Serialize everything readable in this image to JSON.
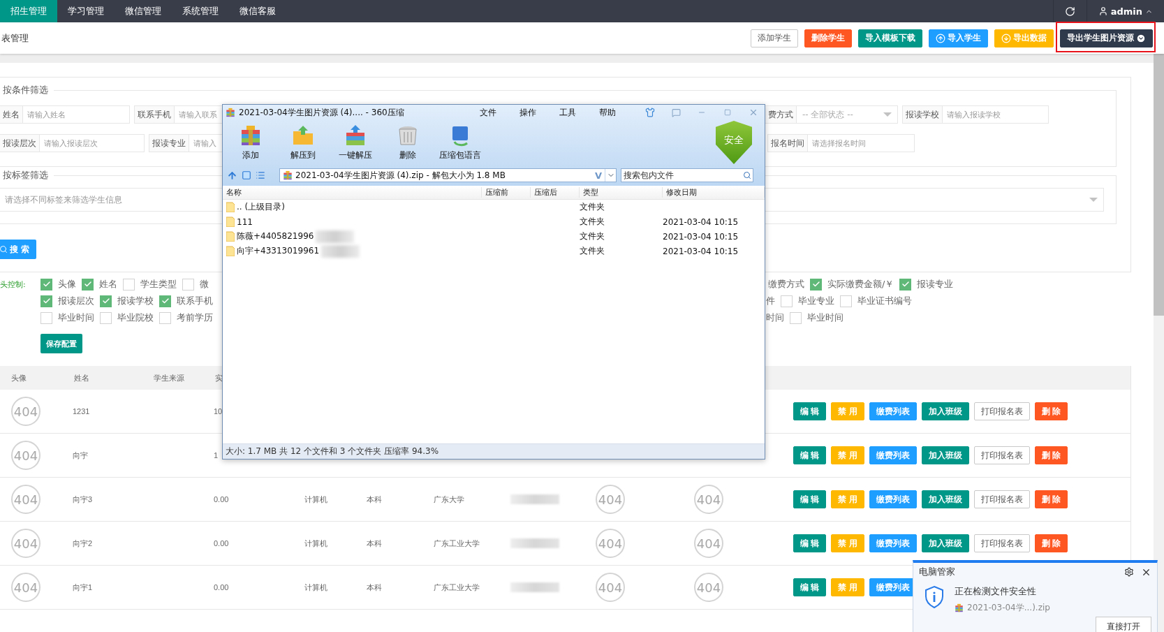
{
  "nav": {
    "items": [
      {
        "label": "招生管理",
        "selected": true
      },
      {
        "label": "学习管理",
        "selected": false
      },
      {
        "label": "微信管理",
        "selected": false
      },
      {
        "label": "系统管理",
        "selected": false
      },
      {
        "label": "微信客服",
        "selected": false
      }
    ],
    "user": "admin"
  },
  "page_title": "表管理",
  "toolbar": [
    {
      "label": "添加学生",
      "kind": "plain"
    },
    {
      "label": "删除学生",
      "kind": "danger"
    },
    {
      "label": "导入模板下载",
      "kind": "primary"
    },
    {
      "label": "导入学生",
      "kind": "info"
    },
    {
      "label": "导出数据",
      "kind": "warn"
    },
    {
      "label": "导出学生图片资源",
      "kind": "dark",
      "highlighted": true
    }
  ],
  "condition_filter": {
    "legend": "按条件筛选",
    "rows": [
      {
        "left": [
          {
            "label": "姓名",
            "placeholder": "请输入姓名",
            "kind": "input"
          },
          {
            "label": "联系手机",
            "placeholder": "请输入联系",
            "kind": "input"
          }
        ],
        "right": [
          {
            "label": "费方式",
            "placeholder": "-- 全部状态 --",
            "kind": "select"
          },
          {
            "label": "报读学校",
            "placeholder": "请输入报读学校",
            "kind": "input"
          }
        ]
      },
      {
        "left": [
          {
            "label": "报读层次",
            "placeholder": "请输入报读层次",
            "kind": "input"
          },
          {
            "label": "报读专业",
            "placeholder": "请输入",
            "kind": "input"
          }
        ],
        "right": [
          {
            "label": "报名时间",
            "placeholder": "请选择报名时间",
            "kind": "input"
          }
        ]
      }
    ]
  },
  "tag_filter": {
    "legend": "按标签筛选",
    "placeholder": "请选择不同标签来筛选学生信息"
  },
  "search_button": "搜 索",
  "column_control": {
    "label": "头控制:",
    "rows": [
      {
        "left": [
          {
            "label": "头像",
            "kind": "checkbox",
            "checked": true
          },
          {
            "label": "姓名",
            "kind": "checkbox",
            "checked": true
          },
          {
            "label": "学生类型",
            "kind": "checkbox",
            "checked": false
          },
          {
            "label": "微",
            "kind": "checkbox",
            "checked": false
          }
        ],
        "right": [
          {
            "label": "缴费方式",
            "kind": "text"
          },
          {
            "label": "实际缴费金额/￥",
            "kind": "checkbox",
            "checked": true
          },
          {
            "label": "报读专业",
            "kind": "checkbox",
            "checked": true
          }
        ]
      },
      {
        "left": [
          {
            "label": "报读层次",
            "kind": "checkbox",
            "checked": true
          },
          {
            "label": "报读学校",
            "kind": "checkbox",
            "checked": true
          },
          {
            "label": "联系手机",
            "kind": "checkbox",
            "checked": true
          }
        ],
        "right": [
          {
            "label": "件",
            "kind": "text"
          },
          {
            "label": "毕业专业",
            "kind": "checkbox",
            "checked": false
          },
          {
            "label": "毕业证书编号",
            "kind": "checkbox",
            "checked": false
          }
        ]
      },
      {
        "left": [
          {
            "label": "毕业时间",
            "kind": "checkbox",
            "checked": false
          },
          {
            "label": "毕业院校",
            "kind": "checkbox",
            "checked": false
          },
          {
            "label": "考前学历",
            "kind": "checkbox",
            "checked": false
          }
        ],
        "right": [
          {
            "label": "时间",
            "kind": "text"
          },
          {
            "label": "毕业时间",
            "kind": "checkbox",
            "checked": false
          }
        ]
      }
    ],
    "save_button": "保存配置"
  },
  "table": {
    "columns": [
      "头像",
      "姓名",
      "学生来源",
      "实"
    ],
    "rows": [
      {
        "avatar": "404",
        "name": "1231",
        "column_4": "10",
        "actions": [
          {
            "label": "编 辑",
            "kind": "edit"
          },
          {
            "label": "禁 用",
            "kind": "disable"
          },
          {
            "label": "缴费列表",
            "kind": "fees"
          },
          {
            "label": "加入班级",
            "kind": "class"
          },
          {
            "label": "打印报名表",
            "kind": "print"
          },
          {
            "label": "删 除",
            "kind": "delete"
          }
        ]
      },
      {
        "avatar": "404",
        "name": "向宇",
        "column_4": "1",
        "actions": [
          {
            "label": "编 辑",
            "kind": "edit"
          },
          {
            "label": "禁 用",
            "kind": "disable"
          },
          {
            "label": "缴费列表",
            "kind": "fees"
          },
          {
            "label": "加入班级",
            "kind": "class"
          },
          {
            "label": "打印报名表",
            "kind": "print"
          },
          {
            "label": "删 除",
            "kind": "delete"
          }
        ]
      },
      {
        "avatar": "404",
        "name": "向宇3",
        "column_4": "0.00",
        "major": "计算机",
        "level": "本科",
        "school": "广东大学",
        "blurred": true,
        "avatar_2": "404",
        "avatar_3": "404",
        "actions": [
          {
            "label": "编 辑",
            "kind": "edit"
          },
          {
            "label": "禁 用",
            "kind": "disable"
          },
          {
            "label": "缴费列表",
            "kind": "fees"
          },
          {
            "label": "加入班级",
            "kind": "class"
          },
          {
            "label": "打印报名表",
            "kind": "print"
          },
          {
            "label": "删 除",
            "kind": "delete"
          }
        ]
      },
      {
        "avatar": "404",
        "name": "向宇2",
        "column_4": "0.00",
        "major": "计算机",
        "level": "本科",
        "school": "广东工业大学",
        "blurred": true,
        "avatar_2": "404",
        "avatar_3": "404",
        "actions": [
          {
            "label": "编 辑",
            "kind": "edit"
          },
          {
            "label": "禁 用",
            "kind": "disable"
          },
          {
            "label": "缴费列表",
            "kind": "fees"
          },
          {
            "label": "加入班级",
            "kind": "class"
          },
          {
            "label": "打印报名表",
            "kind": "print"
          },
          {
            "label": "删 除",
            "kind": "delete"
          }
        ]
      },
      {
        "avatar": "404",
        "name": "向宇1",
        "column_4": "0.00",
        "major": "计算机",
        "level": "本科",
        "school": "广东工业大学",
        "blurred": true,
        "avatar_2": "404",
        "avatar_3": "404",
        "actions": [
          {
            "label": "编 辑",
            "kind": "edit"
          },
          {
            "label": "禁 用",
            "kind": "disable"
          },
          {
            "label": "缴费列表",
            "kind": "fees"
          }
        ]
      }
    ]
  },
  "archive_window": {
    "title": "2021-03-04学生图片资源 (4).... - 360压缩",
    "menu": [
      "文件",
      "操作",
      "工具",
      "帮助"
    ],
    "tools": [
      {
        "label": "添加",
        "kind": "add"
      },
      {
        "label": "解压到",
        "kind": "extract"
      },
      {
        "label": "一键解压",
        "kind": "quick"
      },
      {
        "label": "删除",
        "kind": "delete"
      },
      {
        "label": "压缩包语言",
        "kind": "language"
      }
    ],
    "badge": "安全",
    "path": "2021-03-04学生图片资源 (4).zip - 解包大小为 1.8 MB",
    "path_mark": "V",
    "search_placeholder": "搜索包内文件",
    "columns": [
      "名称",
      "压缩前",
      "压缩后",
      "类型",
      "修改日期"
    ],
    "files": [
      {
        "name": ".. (上级目录)",
        "type": "文件夹"
      },
      {
        "name": "111",
        "type": "文件夹",
        "modified": "2021-03-04 10:15"
      },
      {
        "name": "陈薇+4405821996",
        "type": "文件夹",
        "modified": "2021-03-04 10:15",
        "blurred": true
      },
      {
        "name": "向宇+43313019961",
        "type": "文件夹",
        "modified": "2021-03-04 10:15",
        "blurred": true
      }
    ],
    "status": "大小: 1.7 MB 共 12 个文件和 3 个文件夹 压缩率 94.3%"
  },
  "notification": {
    "title": "电脑管家",
    "message": "正在检测文件安全性",
    "file": "2021-03-04学...).zip",
    "button": "直接打开"
  }
}
